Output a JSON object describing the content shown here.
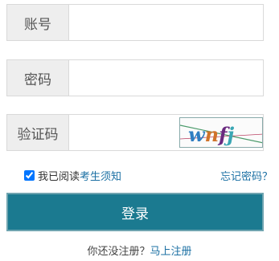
{
  "form": {
    "account_label": "账号",
    "password_label": "密码",
    "captcha_label": "验证码",
    "captcha_text": "wnfj",
    "agree_checked": true,
    "agree_prefix": "我已阅读",
    "agree_link": "考生须知",
    "forgot_link": "忘记密码？",
    "login_button": "登录",
    "register_prompt": "你还没注册？",
    "register_link": "马上注册"
  },
  "colors": {
    "accent": "#1b7a90",
    "link": "#1a6fa3"
  }
}
